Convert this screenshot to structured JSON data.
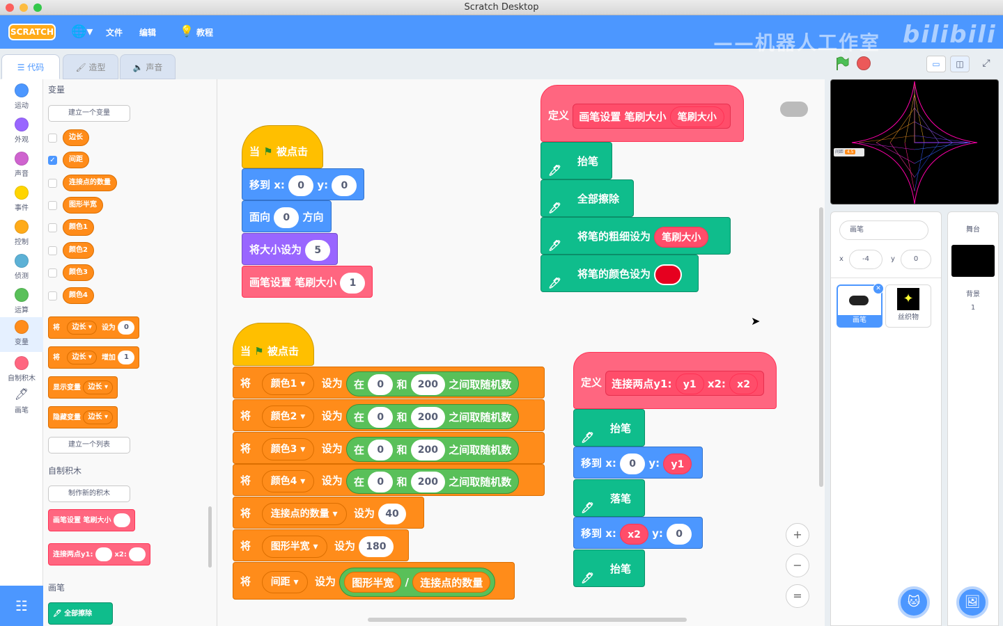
{
  "window": {
    "title": "Scratch Desktop"
  },
  "menu": {
    "logo": "SCRATCH",
    "file": "文件",
    "edit": "编辑",
    "tutorials": "教程",
    "watermark": "——机器人工作室",
    "watermark2": "bilibili"
  },
  "tabs": {
    "code": "代码",
    "costumes": "造型",
    "sounds": "声音"
  },
  "categories": [
    {
      "label": "运动",
      "color": "#4c97ff"
    },
    {
      "label": "外观",
      "color": "#9966ff"
    },
    {
      "label": "声音",
      "color": "#cf63cf"
    },
    {
      "label": "事件",
      "color": "#ffd500"
    },
    {
      "label": "控制",
      "color": "#ffab19"
    },
    {
      "label": "侦测",
      "color": "#5cb1d6"
    },
    {
      "label": "运算",
      "color": "#59c059"
    },
    {
      "label": "变量",
      "color": "#ff8c1a"
    },
    {
      "label": "自制积木",
      "color": "#ff6680"
    },
    {
      "label": "画笔",
      "color": "#0fbd8c"
    }
  ],
  "palette": {
    "variables_heading": "变量",
    "make_variable": "建立一个变量",
    "variables": [
      {
        "name": "边长",
        "checked": false
      },
      {
        "name": "间距",
        "checked": true
      },
      {
        "name": "连接点的数量",
        "checked": false
      },
      {
        "name": "图形半宽",
        "checked": false
      },
      {
        "name": "颜色1",
        "checked": false
      },
      {
        "name": "颜色2",
        "checked": false
      },
      {
        "name": "颜色3",
        "checked": false
      },
      {
        "name": "颜色4",
        "checked": false
      }
    ],
    "set_block": {
      "w1": "将",
      "var": "边长 ▾",
      "w2": "设为",
      "val": "0"
    },
    "change_block": {
      "w1": "将",
      "var": "边长 ▾",
      "w2": "增加",
      "val": "1"
    },
    "show_block": {
      "w1": "显示变量",
      "var": "边长 ▾"
    },
    "hide_block": {
      "w1": "隐藏变量",
      "var": "边长 ▾"
    },
    "make_list": "建立一个列表",
    "myblocks_heading": "自制积木",
    "make_block": "制作新的积木",
    "custom1": "画笔设置 笔刷大小",
    "custom2a": "连接两点y1:",
    "custom2b": "x2:",
    "pen_heading": "画笔",
    "pen_clear": "全部擦除"
  },
  "scripts": {
    "s1": {
      "hat_when": "当",
      "hat_clicked": "被点击",
      "goto_label": "移到 x:",
      "goto_x": "0",
      "goto_y_label": "y:",
      "goto_y": "0",
      "point_label": "面向",
      "point_val": "0",
      "point_dir": "方向",
      "size_label": "将大小设为",
      "size_val": "5",
      "call_label": "画笔设置 笔刷大小",
      "call_val": "1"
    },
    "s2": {
      "define": "定义",
      "proto": "画笔设置 笔刷大小",
      "param": "笔刷大小",
      "pen_up": "抬笔",
      "clear": "全部擦除",
      "size_label": "将笔的粗细设为",
      "size_param": "笔刷大小",
      "color_label": "将笔的颜色设为",
      "color_value": "#e6001f"
    },
    "s3": {
      "hat_when": "当",
      "hat_clicked": "被点击",
      "rows": [
        {
          "w1": "将",
          "var": "颜色1",
          "w2": "设为",
          "r1": "在",
          "a": "0",
          "r2": "和",
          "b": "200",
          "r3": "之间取随机数"
        },
        {
          "w1": "将",
          "var": "颜色2",
          "w2": "设为",
          "r1": "在",
          "a": "0",
          "r2": "和",
          "b": "200",
          "r3": "之间取随机数"
        },
        {
          "w1": "将",
          "var": "颜色3",
          "w2": "设为",
          "r1": "在",
          "a": "0",
          "r2": "和",
          "b": "200",
          "r3": "之间取随机数"
        },
        {
          "w1": "将",
          "var": "颜色4",
          "w2": "设为",
          "r1": "在",
          "a": "0",
          "r2": "和",
          "b": "200",
          "r3": "之间取随机数"
        }
      ],
      "set_count": {
        "w1": "将",
        "var": "连接点的数量",
        "w2": "设为",
        "val": "40"
      },
      "set_half": {
        "w1": "将",
        "var": "图形半宽",
        "w2": "设为",
        "val": "180"
      },
      "set_gap": {
        "w1": "将",
        "var": "间距",
        "w2": "设为",
        "a": "图形半宽",
        "op": "/",
        "b": "连接点的数量"
      }
    },
    "s4": {
      "define": "定义",
      "proto": "连接两点y1:",
      "p1": "y1",
      "p2label": "x2:",
      "p2": "x2",
      "pen_up": "抬笔",
      "goto1_label": "移到 x:",
      "goto1_x": "0",
      "goto1_y_label": "y:",
      "goto1_y": "y1",
      "pen_down": "落笔",
      "goto2_label": "移到 x:",
      "goto2_x": "x2",
      "goto2_y_label": "y:",
      "goto2_y": "0",
      "pen_up2": "抬笔"
    }
  },
  "zoom": {
    "in": "+",
    "out": "−",
    "reset": "="
  },
  "stage_monitor": {
    "label": "间距",
    "value": "4.5"
  },
  "sprite_info": {
    "name": "画笔",
    "x_label": "x",
    "x": "-4",
    "y_label": "y",
    "y": "0"
  },
  "sprites": [
    {
      "name": "画笔",
      "selected": true
    },
    {
      "name": "丝织物",
      "selected": false
    }
  ],
  "stage_panel": {
    "title": "舞台",
    "backdrops_label": "背景",
    "backdrops_count": "1"
  }
}
